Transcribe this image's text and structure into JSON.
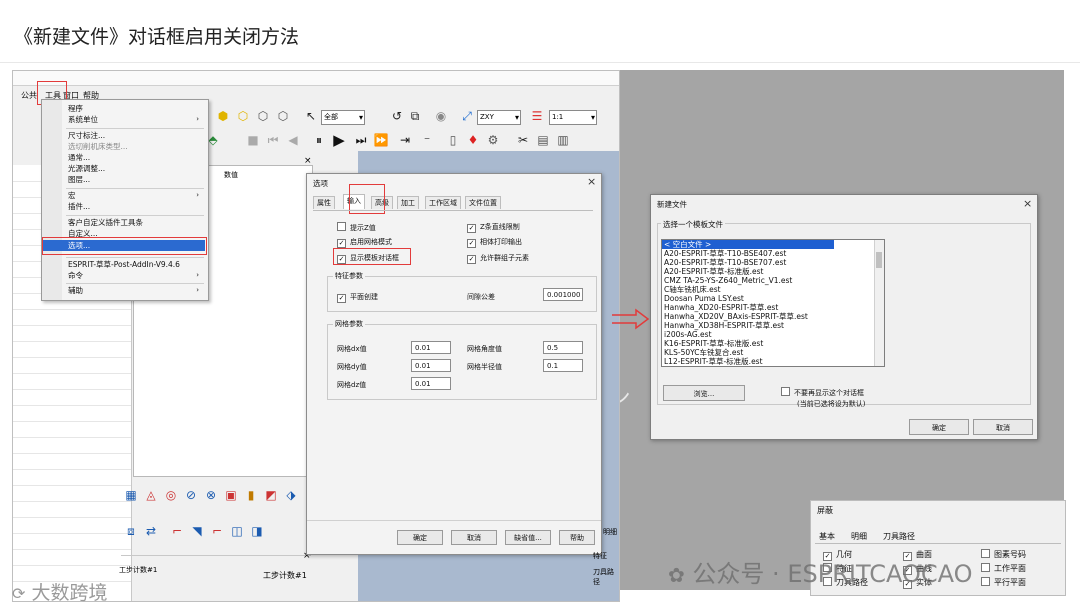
{
  "title": "《新建文件》对话框启用关闭方法",
  "app": {
    "menubar": [
      "公共",
      "工具",
      "窗口",
      "帮助"
    ],
    "toolbar": {
      "combo_all": "全部",
      "combo_zxy": "ZXY",
      "combo_scale": "1:1"
    },
    "column_header": "数值",
    "step_label": "工步计数#1",
    "step_label2": "工步计数#1"
  },
  "tools_menu": {
    "items": [
      {
        "label": "程序",
        "arrow": "›",
        "disabled": false
      },
      {
        "label": "系统单位",
        "arrow": "›",
        "disabled": false
      },
      {
        "label": "尺寸标注...",
        "arrow": "",
        "disabled": false
      },
      {
        "label": "选切削机床类型...",
        "arrow": "",
        "disabled": true
      },
      {
        "label": "通常...",
        "arrow": "",
        "disabled": false
      },
      {
        "label": "光源调整...",
        "arrow": "",
        "disabled": false
      },
      {
        "label": "图层...",
        "arrow": "",
        "disabled": false
      },
      {
        "label": "宏",
        "arrow": "›",
        "disabled": false
      },
      {
        "label": "插件...",
        "arrow": "",
        "disabled": false
      },
      {
        "label": "客户自定义插件工具条",
        "arrow": "",
        "disabled": false
      },
      {
        "label": "自定义...",
        "arrow": "",
        "disabled": false
      },
      {
        "label": "选项...",
        "arrow": "",
        "disabled": false,
        "selected": true
      },
      {
        "label": "ESPRIT-草草-Post-AddIn-V9.4.6",
        "arrow": "",
        "disabled": false
      },
      {
        "label": "命令",
        "arrow": "›",
        "disabled": false
      },
      {
        "label": "辅助",
        "arrow": "›",
        "disabled": false
      }
    ]
  },
  "options_dialog": {
    "title": "选项",
    "close": "×",
    "tabs": [
      "属性",
      "输入",
      "高级",
      "加工",
      "工作区域",
      "文件位置"
    ],
    "checks_left": [
      {
        "label": "提示Z值",
        "checked": false
      },
      {
        "label": "启用网格模式",
        "checked": true
      },
      {
        "label": "显示模板对话框",
        "checked": true
      }
    ],
    "checks_right": [
      {
        "label": "Z条直线限制",
        "checked": true
      },
      {
        "label": "相体打印输出",
        "checked": true
      },
      {
        "label": "允许群组子元素",
        "checked": true
      }
    ],
    "feature_group": "特征参数",
    "plane_create": "平面创建",
    "gap_tol_label": "间隙公差",
    "gap_tol_value": "0.001000",
    "grid_group": "网格参数",
    "grid_rows": [
      {
        "label": "网格dx值",
        "value": "0.01",
        "label2": "网格角度值",
        "value2": "0.5"
      },
      {
        "label": "网格dy值",
        "value": "0.01",
        "label2": "网格半径值",
        "value2": "0.1"
      },
      {
        "label": "网格dz值",
        "value": "0.01",
        "label2": "",
        "value2": ""
      }
    ],
    "buttons": [
      "确定",
      "取消",
      "缺省值...",
      "帮助"
    ]
  },
  "new_file_dialog": {
    "title": "新建文件",
    "close": "×",
    "group_label": "选择一个模板文件",
    "items": [
      "< 空白文件 >",
      "A20-ESPRIT-草草-T10-BSE407.est",
      "A20-ESPRIT-草草-T10-BSE707.est",
      "A20-ESPRIT-草草-标准版.est",
      "CMZ TA-25-YS-Z640_Metric_V1.est",
      "C轴车铣机床.est",
      "Doosan Puma LSY.est",
      "Hanwha_XD20-ESPRIT-草草.est",
      "Hanwha_XD20V_BAxis-ESPRIT-草草.est",
      "Hanwha_XD38H-ESPRIT-草草.est",
      "i200s-AG.est",
      "K16-ESPRIT-草草-标准版.est",
      "KLS-50YC车铣复合.est",
      "L12-ESPRIT-草草-标准版.est"
    ],
    "browse": "浏览...",
    "dont_show": "不要再显示这个对话框",
    "dont_show_note": "(当前已选将设为默认)",
    "ok": "确定",
    "cancel": "取消"
  },
  "screen_panel": {
    "title": "屏蔽",
    "tabs": [
      "基本",
      "明细",
      "刀具路径"
    ],
    "col1": [
      {
        "label": "几何",
        "checked": true
      },
      {
        "label": "特征",
        "checked": false
      },
      {
        "label": "刀具路径",
        "checked": false
      }
    ],
    "col2": [
      {
        "label": "曲面",
        "checked": true
      },
      {
        "label": "曲线",
        "checked": true
      },
      {
        "label": "实体",
        "checked": true
      }
    ],
    "col3": [
      {
        "label": "图素号码",
        "checked": false
      },
      {
        "label": "工作平面",
        "checked": false
      },
      {
        "label": "平行平面",
        "checked": false
      }
    ]
  },
  "side_labels": {
    "a": "明细",
    "b": "特征",
    "c": "刀具路径"
  },
  "watermarks": {
    "left": "大数跨境",
    "right_prefix": "公众号 ·",
    "right": "ESPRITCAOCAO"
  }
}
